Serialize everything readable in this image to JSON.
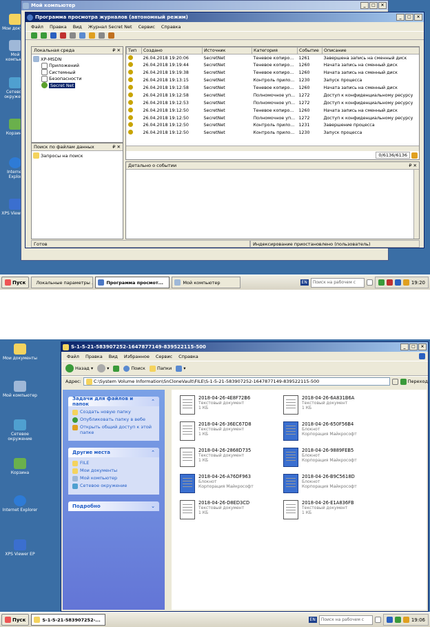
{
  "s1": {
    "desktop": [
      {
        "label": "Мои докуме"
      },
      {
        "label": "Мой компьют"
      },
      {
        "label": "Сетевое окружени"
      },
      {
        "label": "Корзина"
      },
      {
        "label": "Internet Explor"
      },
      {
        "label": "XPS Viewer E"
      }
    ],
    "bg_window": {
      "title": "Мой компьютер"
    },
    "window": {
      "title": "Программа просмотра журналов (автономный режим)",
      "menu": [
        "Файл",
        "Правка",
        "Вид",
        "Журнал Secret Net",
        "Сервис",
        "Справка"
      ],
      "tree_header": "Локальная среда",
      "tree_pin": "₽ ✕",
      "tree": [
        "XP-MSDN",
        "Приложений",
        "Системный",
        "Безопасности",
        "Secret Net"
      ],
      "search_header": "Поиск по файлам данных",
      "search_item": "Запросы на поиск",
      "columns": [
        "Тип",
        "Создано",
        "Источник",
        "Категория",
        "Событие",
        "Описание"
      ],
      "rows": [
        [
          "26.04.2018  19:20:06",
          "SecretNet",
          "Теневое копиро...",
          "1261",
          "Завершена запись на сменный диск"
        ],
        [
          "26.04.2018  19:19:44",
          "SecretNet",
          "Теневое копиро...",
          "1260",
          "Начата запись на сменный диск"
        ],
        [
          "26.04.2018  19:19:38",
          "SecretNet",
          "Теневое копиро...",
          "1260",
          "Начата запись на сменный диск"
        ],
        [
          "26.04.2018  19:13:15",
          "SecretNet",
          "Контроль прило...",
          "1230",
          "Запуск процесса"
        ],
        [
          "26.04.2018  19:12:58",
          "SecretNet",
          "Теневое копиро...",
          "1260",
          "Начата запись на сменный диск"
        ],
        [
          "26.04.2018  19:12:58",
          "SecretNet",
          "Полномочное уп...",
          "1272",
          "Доступ к конфиденциальному ресурсу"
        ],
        [
          "26.04.2018  19:12:53",
          "SecretNet",
          "Полномочное уп...",
          "1272",
          "Доступ к конфиденциальному ресурсу"
        ],
        [
          "26.04.2018  19:12:50",
          "SecretNet",
          "Теневое копиро...",
          "1260",
          "Начата запись на сменный диск"
        ],
        [
          "26.04.2018  19:12:50",
          "SecretNet",
          "Полномочное уп...",
          "1272",
          "Доступ к конфиденциальному ресурсу"
        ],
        [
          "26.04.2018  19:12:50",
          "SecretNet",
          "Контроль прило...",
          "1231",
          "Завершение процесса"
        ],
        [
          "26.04.2018  19:12:50",
          "SecretNet",
          "Контроль прило...",
          "1230",
          "Запуск процесса"
        ]
      ],
      "counter": "0/6136/6136",
      "detail_header": "Детально о событии",
      "status_left": "Готов",
      "status_right": "Индексирование приостановлено (пользователь)"
    },
    "taskbar": {
      "start": "Пуск",
      "buttons": [
        "Локальные параметры ...",
        "Программа просмот...",
        "Мой компьютер"
      ],
      "lang": "EN",
      "search": "Поиск на рабочем с",
      "clock": "19:20"
    }
  },
  "s2": {
    "desktop": [
      {
        "label": "Мои документы"
      },
      {
        "label": "Мой компьютер"
      },
      {
        "label": "Сетевое окружение"
      },
      {
        "label": "Корзина"
      },
      {
        "label": "Internet Explorer"
      },
      {
        "label": "XPS Viewer EP"
      }
    ],
    "window": {
      "title": "S-1-5-21-583907252-1647877149-839522115-500",
      "menu": [
        "Файл",
        "Правка",
        "Вид",
        "Избранное",
        "Сервис",
        "Справка"
      ],
      "back": "Назад",
      "search": "Поиск",
      "folders": "Папки",
      "addr_label": "Адрес:",
      "address": "C:\\System Volume Information\\SnCloneVault\\FILE\\S-1-5-21-583907252-1647877149-839522115-500",
      "go": "Переход",
      "tasks_title": "Задачи для файлов и папок",
      "tasks": [
        "Создать новую папку",
        "Опубликовать папку в вебе",
        "Открыть общий доступ к этой папке"
      ],
      "other_title": "Другие места",
      "other": [
        "FILE",
        "Мои документы",
        "Мой компьютер",
        "Сетевое окружение"
      ],
      "details_title": "Подробно",
      "files": [
        {
          "name": "2018-04-26-4E8F72B6",
          "type": "Текстовый документ",
          "extra": "1 КБ",
          "np": false
        },
        {
          "name": "2018-04-26-6A831B6A",
          "type": "Текстовый документ",
          "extra": "1 КБ",
          "np": false
        },
        {
          "name": "2018-04-26-36EC67D8",
          "type": "Текстовый документ",
          "extra": "1 КБ",
          "np": false
        },
        {
          "name": "2018-04-26-650F56B4",
          "type": "Блокнот",
          "extra": "Корпорация Майкрософт",
          "np": true
        },
        {
          "name": "2018-04-26-2868D735",
          "type": "Текстовый документ",
          "extra": "1 КБ",
          "np": false
        },
        {
          "name": "2018-04-26-9889FEB5",
          "type": "Блокнот",
          "extra": "Корпорация Майкрософт",
          "np": true
        },
        {
          "name": "2018-04-26-A76DF963",
          "type": "Блокнот",
          "extra": "Корпорация Майкрософт",
          "np": true
        },
        {
          "name": "2018-04-26-B9C5618D",
          "type": "Блокнот",
          "extra": "Корпорация Майкрософт",
          "np": true
        },
        {
          "name": "2018-04-26-D8ED3CD",
          "type": "Текстовый документ",
          "extra": "1 КБ",
          "np": false
        },
        {
          "name": "2018-04-26-E1A836FB",
          "type": "Текстовый документ",
          "extra": "1 КБ",
          "np": false
        }
      ]
    },
    "taskbar": {
      "start": "Пуск",
      "buttons": [
        "S-1-5-21-583907252-..."
      ],
      "lang": "EN",
      "search": "Поиск на рабочем с",
      "clock": "19:06"
    }
  }
}
